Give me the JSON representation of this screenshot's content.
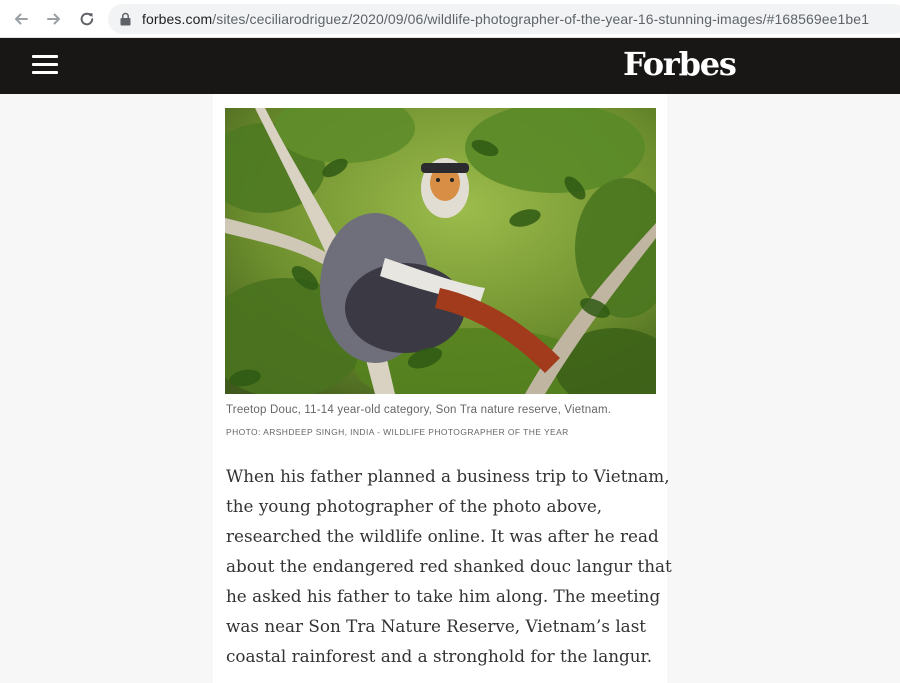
{
  "browser": {
    "url_host": "forbes.com",
    "url_path": "/sites/ceciliarodriguez/2020/09/06/wildlife-photographer-of-the-year-16-stunning-images/#168569ee1be1"
  },
  "header": {
    "logo": "Forbes",
    "menu_icon": "hamburger-menu-icon",
    "bg_color": "#181716"
  },
  "article": {
    "image_caption": "Treetop Douc, 11-14 year-old category, Son Tra nature reserve, Vietnam.",
    "image_credit": "PHOTO: ARSHDEEP SINGH, INDIA - WILDLIFE PHOTOGRAPHER OF THE YEAR",
    "body_lines": [
      "When his father planned a business trip to Vietnam,",
      "the young photographer of the photo above,",
      "researched the wildlife online. It was after he read",
      "about the endangered red shanked douc langur that",
      "he asked his father to take him along. The meeting",
      "was near Son Tra Nature Reserve, Vietnam’s last",
      "coastal rainforest and a stronghold for the langur."
    ]
  }
}
